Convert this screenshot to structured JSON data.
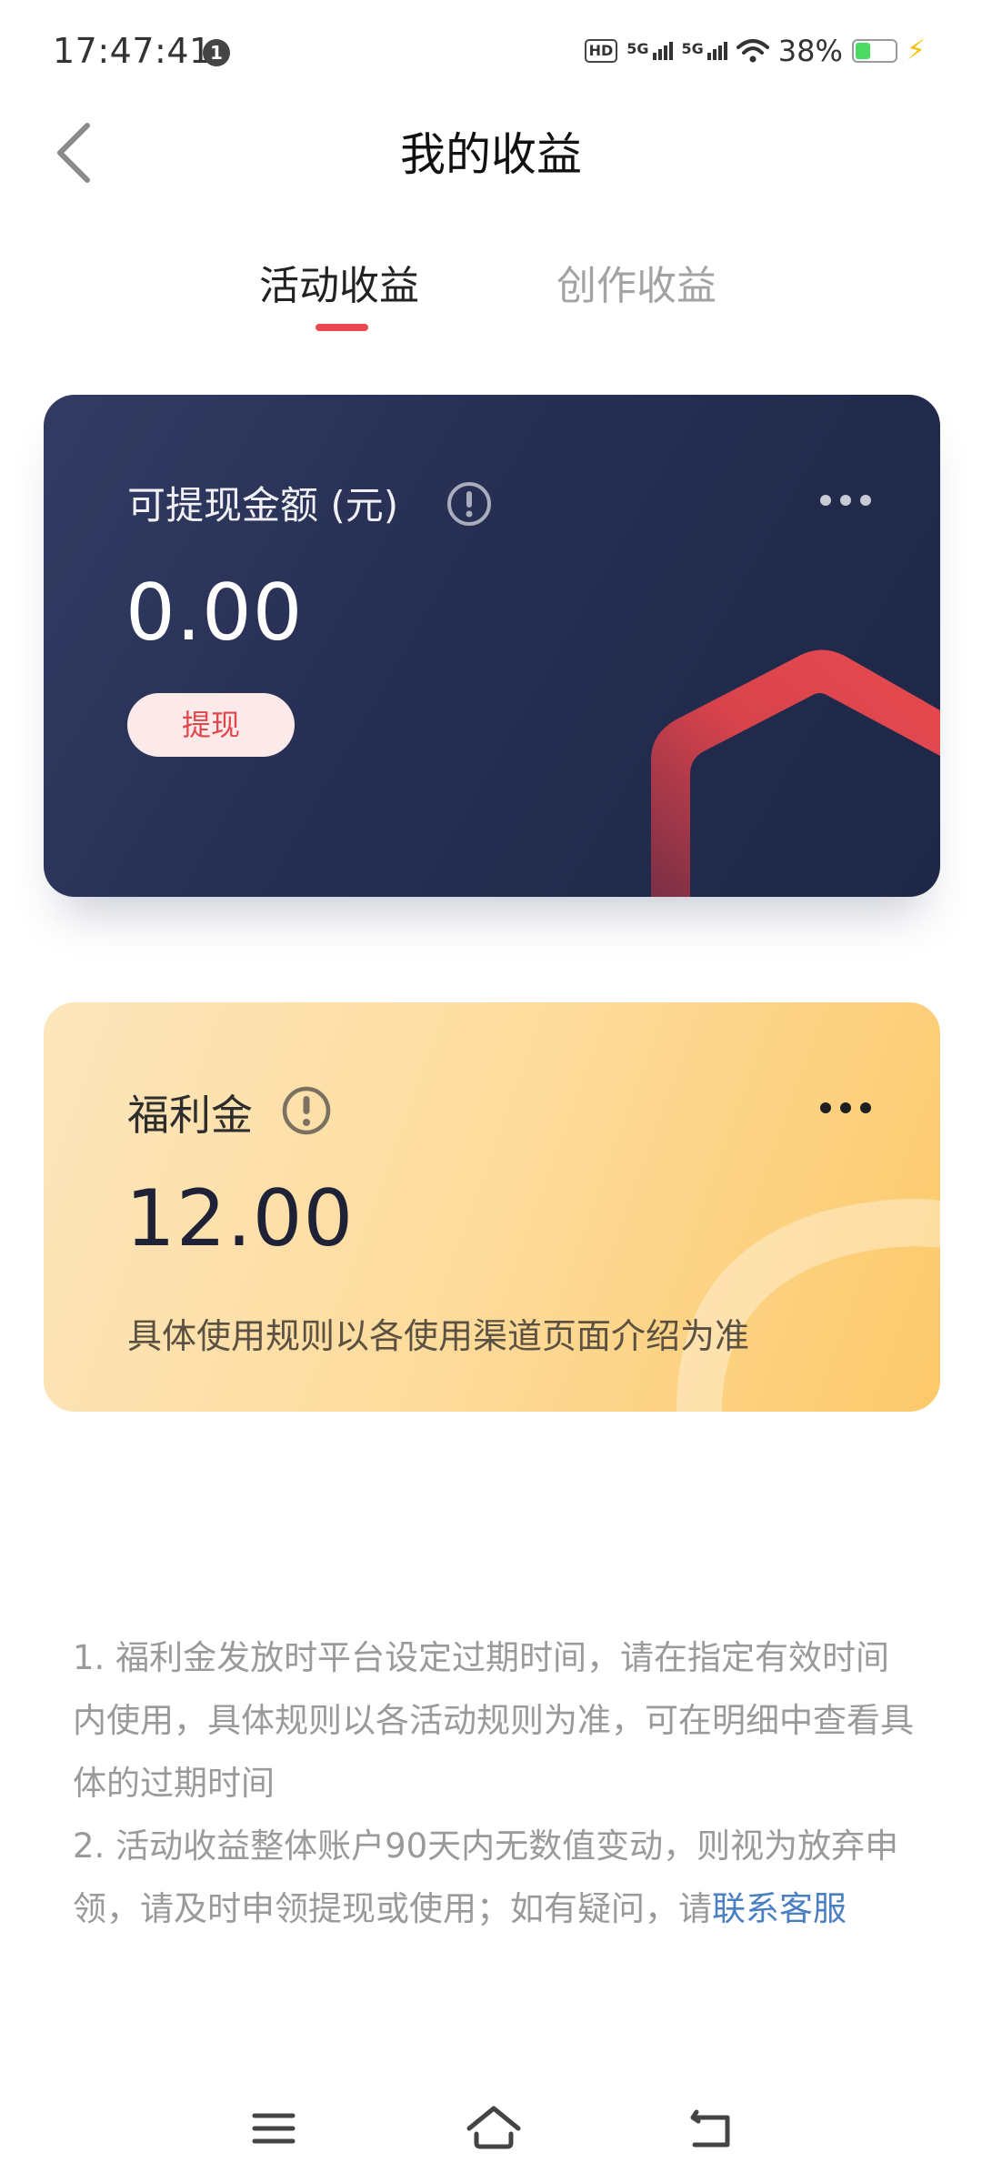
{
  "status_bar": {
    "time": "17:47:41",
    "notification_badge": "1",
    "hd_badge": "HD",
    "network_1": "5G",
    "network_2": "5G",
    "battery": "38%"
  },
  "header": {
    "title": "我的收益",
    "back_icon": "chevron-left-icon"
  },
  "tabs": [
    {
      "label": "活动收益",
      "active": true
    },
    {
      "label": "创作收益",
      "active": false
    }
  ],
  "cash_card": {
    "label": "可提现金额 (元)",
    "amount": "0.00",
    "button": "提现",
    "more_icon": "more-dots-icon",
    "info_icon": "info-icon"
  },
  "welfare_card": {
    "label": "福利金",
    "amount": "12.00",
    "note": "具体使用规则以各使用渠道页面介绍为准",
    "more_icon": "more-dots-icon",
    "info_icon": "info-icon"
  },
  "notes": {
    "item1": "1. 福利金发放时平台设定过期时间，请在指定有效时间内使用，具体规则以各活动规则为准，可在明细中查看具体的过期时间",
    "item2": "2. 活动收益整体账户90天内无数值变动，则视为放弃申领，请及时申领提现或使用；如有疑问，请",
    "link": "联系客服"
  },
  "nav_bar": {
    "icons": [
      "menu-icon",
      "home-icon",
      "back-icon"
    ]
  },
  "colors": {
    "accent": "#e84a4f",
    "cash_card_bg": "#262e52",
    "welfare_card_bg": "#fdd58a",
    "link": "#4a7fc2"
  }
}
